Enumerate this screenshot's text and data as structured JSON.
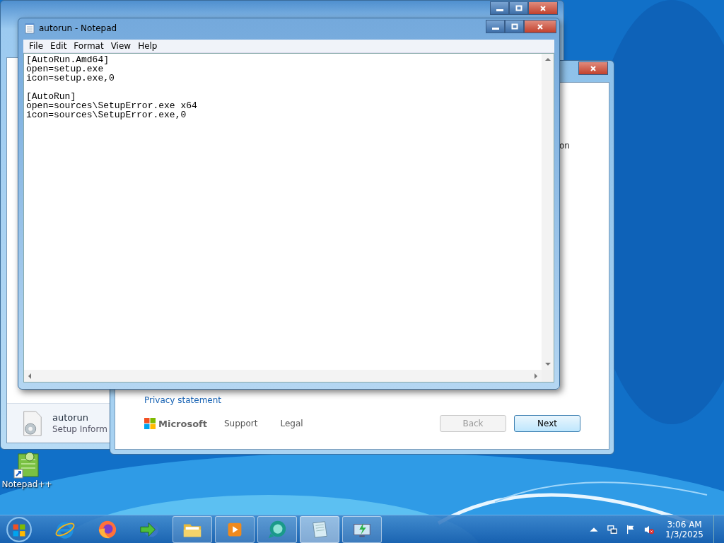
{
  "back_window": {
    "file": {
      "name": "autorun",
      "type": "Setup Inform"
    }
  },
  "setup_window": {
    "text_fragment": "on",
    "privacy_link": "Privacy statement",
    "footer": {
      "brand": "Microsoft",
      "links": [
        "Support",
        "Legal"
      ]
    },
    "buttons": [
      {
        "label": "Back",
        "disabled": true
      },
      {
        "label": "Next",
        "disabled": false
      }
    ]
  },
  "notepad": {
    "title": "autorun - Notepad",
    "menu": [
      "File",
      "Edit",
      "Format",
      "View",
      "Help"
    ],
    "text": "[AutoRun.Amd64]\nopen=setup.exe\nicon=setup.exe,0\n\n[AutoRun]\nopen=sources\\SetupError.exe x64\nicon=sources\\SetupError.exe,0"
  },
  "desktop": {
    "icons": [
      {
        "label": "Notepad++"
      }
    ]
  },
  "taskbar": {
    "items": [
      {
        "kind": "ie",
        "running": false,
        "selected": false
      },
      {
        "kind": "firefox",
        "running": false,
        "selected": false
      },
      {
        "kind": "download",
        "running": false,
        "selected": false
      },
      {
        "kind": "folder",
        "running": true,
        "selected": false
      },
      {
        "kind": "media",
        "running": true,
        "selected": false
      },
      {
        "kind": "chat",
        "running": true,
        "selected": false
      },
      {
        "kind": "notepad",
        "running": true,
        "selected": true
      },
      {
        "kind": "monitor",
        "running": true,
        "selected": false
      }
    ],
    "tray": {
      "muted": true
    },
    "clock": {
      "time": "3:06 AM",
      "date": "1/3/2025"
    }
  }
}
